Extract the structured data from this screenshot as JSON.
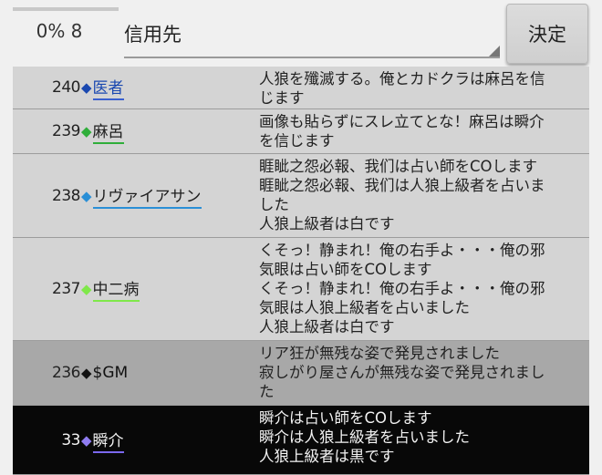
{
  "header": {
    "progress_text": "0% 8",
    "progress_percent": 0,
    "select_value": "信用先",
    "decide_label": "決定"
  },
  "rows": [
    {
      "num": "240",
      "diamond_color": "#1a48b0",
      "name": "医者",
      "name_color": "#1a48b0",
      "underline": "#3a5fcf",
      "style": "normal",
      "message": "人狼を殲滅する。俺とカドクラは麻呂を信\nじます"
    },
    {
      "num": "239",
      "diamond_color": "#2fae3a",
      "name": "麻呂",
      "name_color": "#1e1e1e",
      "underline": "#2fae3a",
      "style": "normal",
      "message": "画像も貼らずにスレ立てとな！麻呂は瞬介\nを信じます"
    },
    {
      "num": "238",
      "diamond_color": "#2a8fd6",
      "name": "リヴァイアサン",
      "name_color": "#1e1e1e",
      "underline": "#2a8fd6",
      "style": "normal",
      "message": "睚眦之怨必報、我们は占い師をCOします\n睚眦之怨必報、我们は人狼上級者を占いま\nした\n人狼上級者は白です"
    },
    {
      "num": "237",
      "diamond_color": "#7fe84a",
      "name": "中二病",
      "name_color": "#1e1e1e",
      "underline": "#7fe84a",
      "style": "normal",
      "message": "くそっ！静まれ！俺の右手よ・・・俺の邪\n気眼は占い師をCOします\nくそっ！静まれ！俺の右手よ・・・俺の邪\n気眼は人狼上級者を占いました\n人狼上級者は白です"
    },
    {
      "num": "236",
      "diamond_color": "#111111",
      "name": "$GM",
      "name_color": "#111111",
      "underline": "",
      "style": "gm",
      "message": "リア狂が無残な姿で発見されました\n寂しがり屋さんが無残な姿で発見されまし\nた"
    },
    {
      "num": "33",
      "diamond_color": "#8f7cf0",
      "name": "瞬介",
      "name_color": "#f2f2f2",
      "underline": "#7b68ee",
      "style": "dark",
      "message": "瞬介は占い師をCOします\n瞬介は人狼上級者を占いました\n人狼上級者は黒です"
    }
  ]
}
